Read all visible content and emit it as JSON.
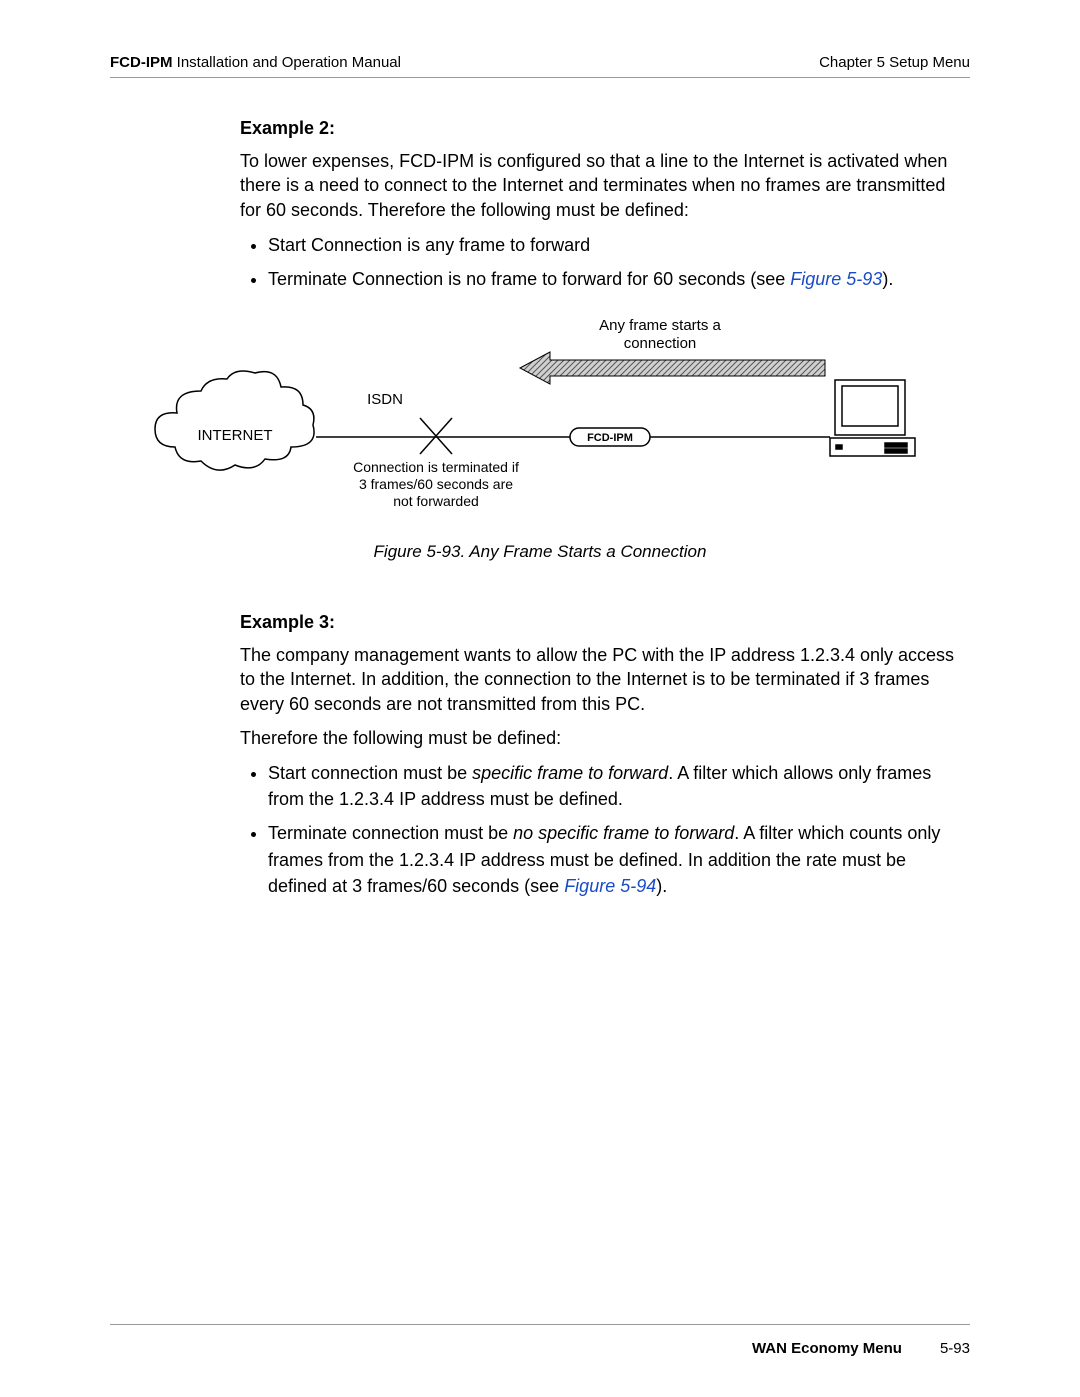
{
  "header": {
    "doc_bold": "FCD-IPM",
    "doc_rest": " Installation and Operation Manual",
    "chapter": "Chapter 5  Setup Menu"
  },
  "ex2": {
    "heading": "Example 2:",
    "para": "To lower expenses, FCD-IPM is configured so that a line to the Internet is activated when there is a need to connect to the Internet and terminates when no frames are transmitted for 60 seconds. Therefore the following must be defined:",
    "bullet1": "Start Connection is any frame to forward",
    "bullet2_pre": "Terminate Connection is no frame to forward for 60 seconds (see ",
    "bullet2_ref": "Figure 5-93",
    "bullet2_post": ")."
  },
  "figure": {
    "top1": "Any frame starts a",
    "top2": "connection",
    "isdn": "ISDN",
    "internet": "INTERNET",
    "device": "FCD-IPM",
    "term1": "Connection is terminated if",
    "term2": "3 frames/60 seconds are",
    "term3": "not forwarded",
    "caption": "Figure 5-93.  Any Frame Starts a Connection"
  },
  "ex3": {
    "heading": "Example 3:",
    "para1": "The company management wants to allow the PC with the IP address 1.2.3.4 only access to the Internet. In addition, the connection to the Internet is to be terminated if 3 frames every 60 seconds are not transmitted from this PC.",
    "para2": "Therefore the following must be defined:",
    "b1_pre": "Start connection must be ",
    "b1_ital": "specific frame to forward",
    "b1_post": ". A filter which allows only frames from the 1.2.3.4 IP address must be defined.",
    "b2_pre": "Terminate connection must be ",
    "b2_ital": "no specific frame to forward",
    "b2_mid": ". A filter which counts only frames from the 1.2.3.4 IP address must be defined. In addition the rate must be defined at 3 frames/60 seconds (see ",
    "b2_ref": "Figure 5-94",
    "b2_post": ")."
  },
  "footer": {
    "section": "WAN Economy Menu",
    "page": "5-93"
  }
}
